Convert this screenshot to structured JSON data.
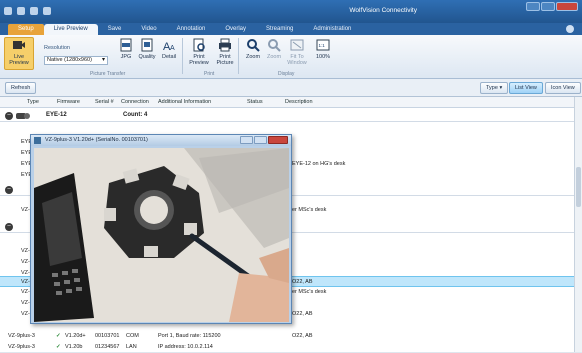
{
  "app": {
    "title": "WolfVision Connectivity"
  },
  "ribbon": {
    "tabs": [
      "Setup",
      "Live Preview",
      "Save",
      "Video",
      "Annotation",
      "Overlay",
      "Streaming",
      "Administration"
    ],
    "live_preview_label": "Live Preview",
    "resolution_label": "Resolution",
    "resolution_value": "Native (1280x960)",
    "jpg_label": "JPG",
    "quality_label": "Quality",
    "detail_label": "Detail",
    "picture_transfer_group": "Picture Transfer",
    "print_preview_label": "Print Preview",
    "print_picture_label": "Print Picture",
    "print_group": "Print",
    "zoom_label": "Zoom",
    "zoom_out_label": "Zoom",
    "fit_to_window_label": "Fit To Window",
    "percent_label": "100%",
    "display_group": "Display"
  },
  "toolbar": {
    "refresh": "Refresh",
    "type": "Type",
    "list_view": "List View",
    "icon_view": "Icon View"
  },
  "list": {
    "columns": [
      "Type",
      "Firmware",
      "Serial #",
      "Connection",
      "Additional Information",
      "Status",
      "Description"
    ],
    "group1": {
      "name": "EYE-12",
      "count": "Count: 4"
    },
    "group1_rows": [
      {
        "type": "EYE",
        "desc": ""
      },
      {
        "type": "EYE",
        "desc": ""
      },
      {
        "type": "EYE",
        "desc": "EYE-12 on HG's desk"
      },
      {
        "type": "EYE",
        "desc": ""
      }
    ],
    "group2_rows": [
      {
        "type": "VZ-",
        "desc": "er MSc's desk"
      }
    ],
    "group3_rows": [
      {
        "type": "VZ-",
        "desc": ""
      },
      {
        "type": "VZ-",
        "desc": ""
      },
      {
        "type": "VZ-",
        "desc": ""
      },
      {
        "type": "VZ-",
        "desc": ""
      },
      {
        "type": "VZ-",
        "desc": "O22, AB"
      },
      {
        "type": "VZ-",
        "desc": "er MSc's desk"
      },
      {
        "type": "VZ-",
        "desc": ""
      },
      {
        "type": "VZ-",
        "desc": "O22, AB"
      }
    ],
    "bottom_rows": [
      {
        "type": "VZ-9plus-3",
        "fw": "V1.20d+",
        "serial": "00103701",
        "conn": "COM",
        "info": "Port 1, Baud rate: 115200",
        "desc": "O22, AB"
      },
      {
        "type": "VZ-9plus-3",
        "fw": "V1.20b",
        "serial": "01234567",
        "conn": "LAN",
        "info": "IP address: 10.0.2.114",
        "desc": ""
      }
    ]
  },
  "popup": {
    "title": "VZ-9plus-3 V1.20d+ (SerialNo. 00103701)"
  },
  "colors": {
    "title_bar": "#2f6fb4",
    "selected_row": "#bfe6fb",
    "file_tab": "#e8a33a"
  }
}
